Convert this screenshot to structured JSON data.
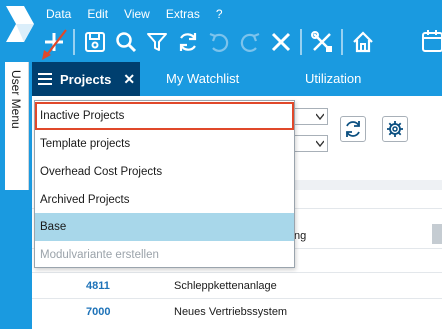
{
  "menubar": {
    "items": [
      "Data",
      "Edit",
      "View",
      "Extras",
      "?"
    ]
  },
  "toolbar": {
    "icons": [
      "add-icon",
      "save-icon",
      "search-icon",
      "filter-icon",
      "refresh-icon",
      "undo-icon",
      "redo-icon",
      "delete-icon",
      "tools-icon",
      "home-icon",
      "calendar-icon"
    ]
  },
  "side": {
    "user_menu_label": "User Menu"
  },
  "tabs": {
    "active": {
      "label": "Projects",
      "close": "✕"
    },
    "others": [
      "My Watchlist",
      "Utilization"
    ]
  },
  "dropdown": {
    "items": [
      {
        "label": "Inactive Projects",
        "state": "highlighted"
      },
      {
        "label": "Template projects",
        "state": "normal"
      },
      {
        "label": "Overhead Cost Projects",
        "state": "normal"
      },
      {
        "label": "Archived Projects",
        "state": "normal"
      },
      {
        "label": "Base",
        "state": "selected"
      },
      {
        "label": "Modulvariante erstellen",
        "state": "disabled"
      }
    ]
  },
  "table": {
    "partial_header": "ng",
    "rows": [
      {
        "id": "4811",
        "name": "Schleppkettenanlage"
      },
      {
        "id": "7000",
        "name": "Neues Vertriebssystem"
      }
    ]
  },
  "colors": {
    "brand_blue": "#1a9ae0",
    "active_tab": "#003f6f",
    "selection": "#a8d7ea",
    "highlight_border": "#e0482a",
    "link_id": "#1d72b8"
  }
}
